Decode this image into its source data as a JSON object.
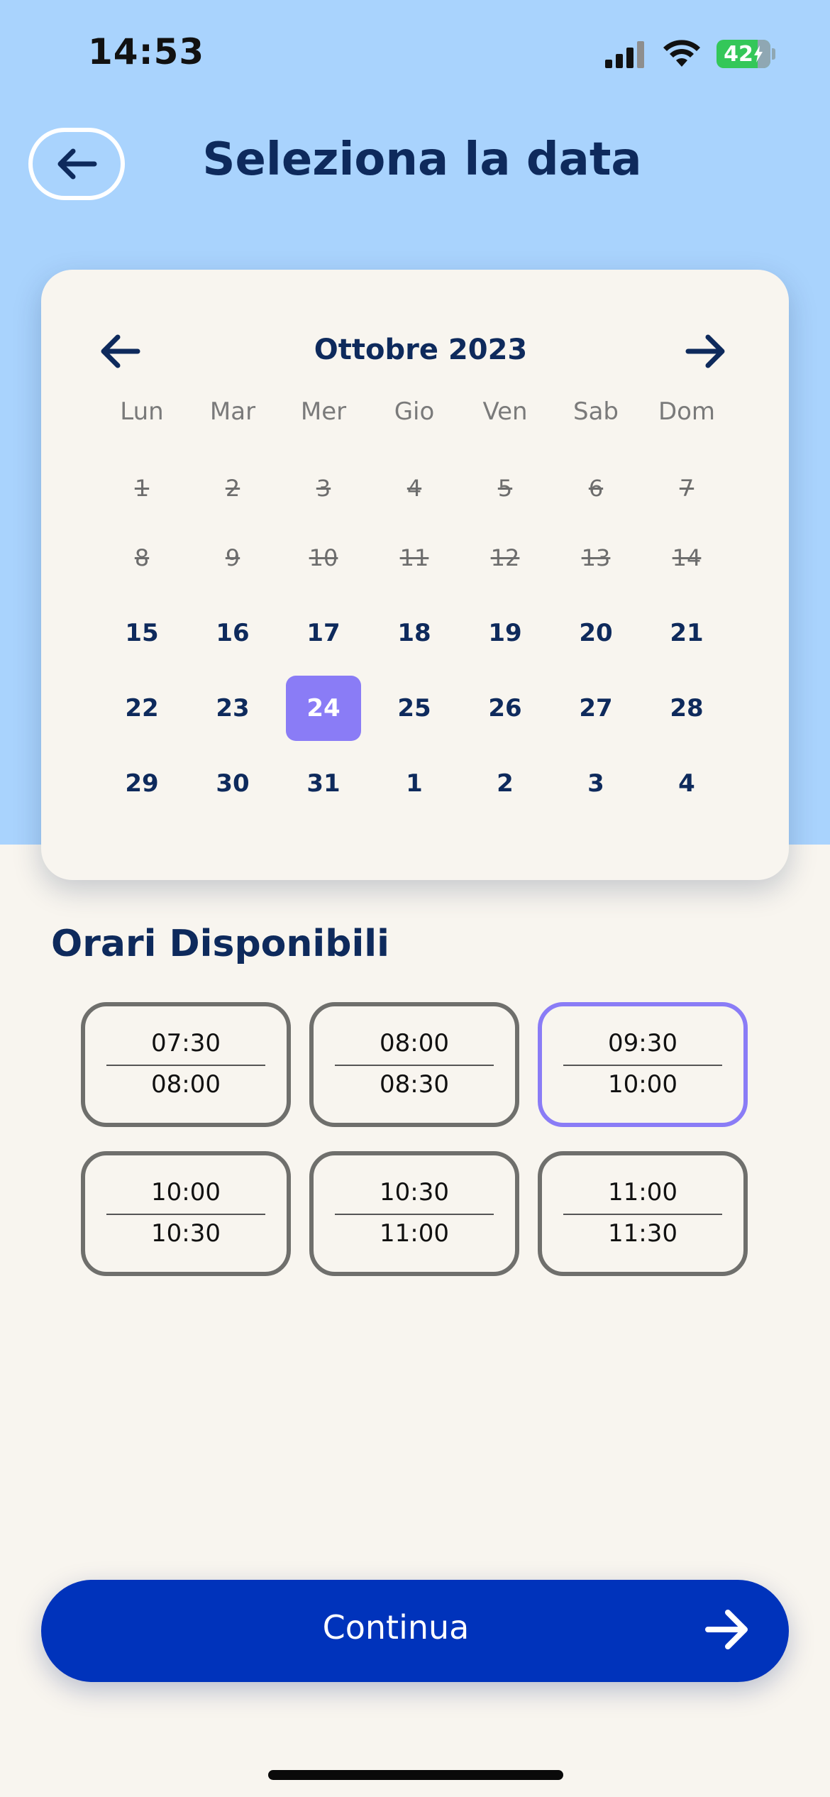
{
  "status_bar": {
    "time": "14:53",
    "battery": "42",
    "icons": [
      "signal-icon",
      "wifi-icon",
      "battery-charging-icon"
    ]
  },
  "header": {
    "title": "Seleziona la data",
    "back_icon": "arrow-left-icon"
  },
  "calendar": {
    "month_label": "Ottobre 2023",
    "prev_icon": "arrow-left-icon",
    "next_icon": "arrow-right-icon",
    "weekdays": [
      "Lun",
      "Mar",
      "Mer",
      "Gio",
      "Ven",
      "Sab",
      "Dom"
    ],
    "weeks": [
      [
        {
          "d": "1",
          "s": "disabled"
        },
        {
          "d": "2",
          "s": "disabled"
        },
        {
          "d": "3",
          "s": "disabled"
        },
        {
          "d": "4",
          "s": "disabled"
        },
        {
          "d": "5",
          "s": "disabled"
        },
        {
          "d": "6",
          "s": "disabled"
        },
        {
          "d": "7",
          "s": "disabled"
        }
      ],
      [
        {
          "d": "8",
          "s": "disabled"
        },
        {
          "d": "9",
          "s": "disabled"
        },
        {
          "d": "10",
          "s": "disabled"
        },
        {
          "d": "11",
          "s": "disabled"
        },
        {
          "d": "12",
          "s": "disabled"
        },
        {
          "d": "13",
          "s": "disabled"
        },
        {
          "d": "14",
          "s": "disabled"
        }
      ],
      [
        {
          "d": "15",
          "s": "available"
        },
        {
          "d": "16",
          "s": "available"
        },
        {
          "d": "17",
          "s": "available"
        },
        {
          "d": "18",
          "s": "available"
        },
        {
          "d": "19",
          "s": "available"
        },
        {
          "d": "20",
          "s": "available"
        },
        {
          "d": "21",
          "s": "available"
        }
      ],
      [
        {
          "d": "22",
          "s": "available"
        },
        {
          "d": "23",
          "s": "available"
        },
        {
          "d": "24",
          "s": "selected"
        },
        {
          "d": "25",
          "s": "available"
        },
        {
          "d": "26",
          "s": "available"
        },
        {
          "d": "27",
          "s": "available"
        },
        {
          "d": "28",
          "s": "available"
        }
      ],
      [
        {
          "d": "29",
          "s": "available"
        },
        {
          "d": "30",
          "s": "available"
        },
        {
          "d": "31",
          "s": "available"
        },
        {
          "d": "1",
          "s": "available"
        },
        {
          "d": "2",
          "s": "available"
        },
        {
          "d": "3",
          "s": "available"
        },
        {
          "d": "4",
          "s": "available"
        }
      ]
    ]
  },
  "times": {
    "title": "Orari Disponibili",
    "slots": [
      {
        "start": "07:30",
        "end": "08:00",
        "selected": false
      },
      {
        "start": "08:00",
        "end": "08:30",
        "selected": false
      },
      {
        "start": "09:30",
        "end": "10:00",
        "selected": true
      },
      {
        "start": "10:00",
        "end": "10:30",
        "selected": false
      },
      {
        "start": "10:30",
        "end": "11:00",
        "selected": false
      },
      {
        "start": "11:00",
        "end": "11:30",
        "selected": false
      }
    ]
  },
  "continue_button": {
    "label": "Continua",
    "icon": "arrow-right-icon"
  },
  "colors": {
    "header_bg": "#a9d3fd",
    "page_bg": "#f8f5ef",
    "primary_text": "#0e2a5c",
    "accent_selected": "#8a7cf6",
    "button_blue": "#0033bb",
    "battery_green": "#34c759"
  }
}
